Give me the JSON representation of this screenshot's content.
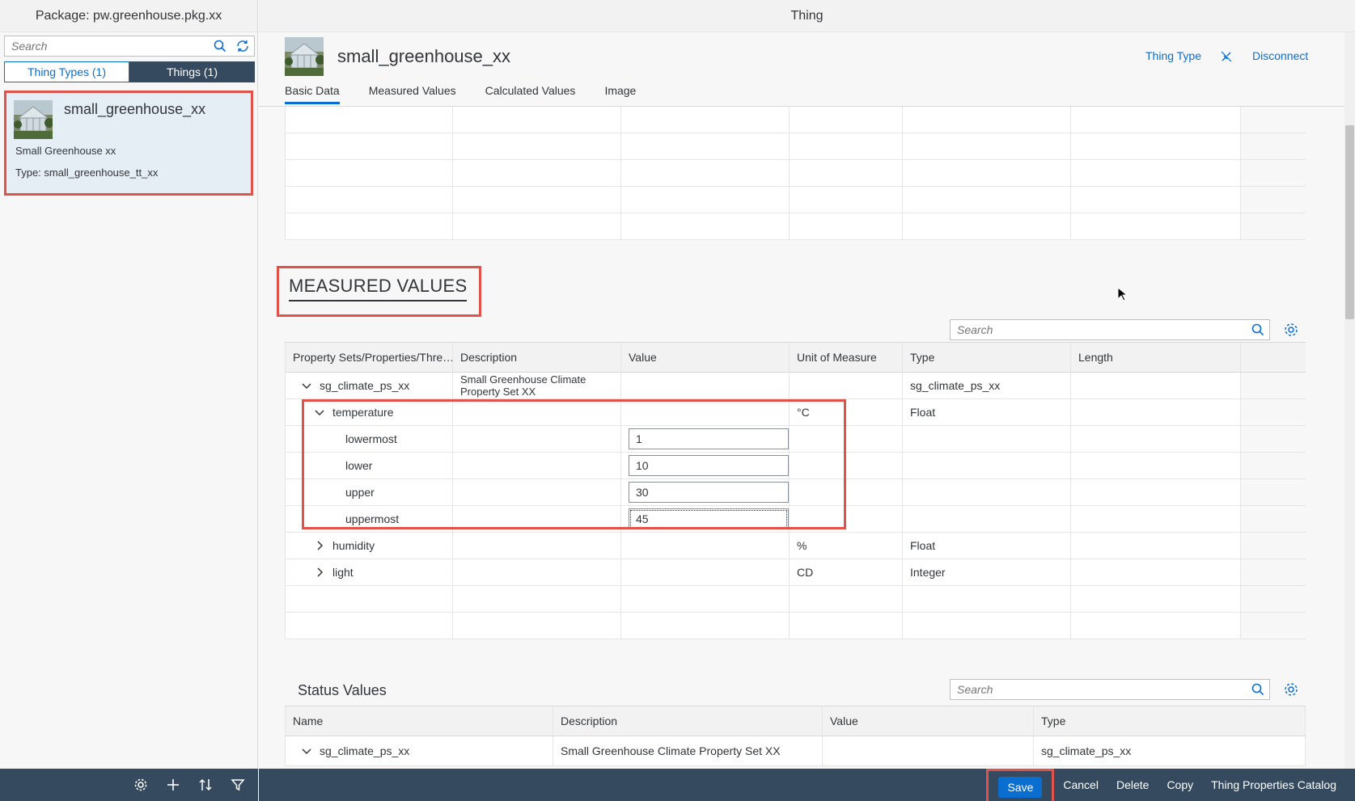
{
  "left": {
    "header": "Package: pw.greenhouse.pkg.xx",
    "search_placeholder": "Search",
    "tabs": [
      "Thing Types (1)",
      "Things (1)"
    ],
    "card": {
      "title": "small_greenhouse_xx",
      "description": "Small Greenhouse xx",
      "type": "Type: small_greenhouse_tt_xx"
    }
  },
  "main": {
    "header": "Thing",
    "title": "small_greenhouse_xx",
    "actions": {
      "thing_type": "Thing Type",
      "disconnect": "Disconnect"
    },
    "tabs": [
      "Basic Data",
      "Measured Values",
      "Calculated Values",
      "Image"
    ],
    "measured_values": {
      "title": "MEASURED VALUES",
      "search_placeholder": "Search",
      "columns": [
        "Property Sets/Properties/Thre…",
        "Description",
        "Value",
        "Unit of Measure",
        "Type",
        "Length"
      ],
      "rows": [
        {
          "name": "sg_climate_ps_xx",
          "description": "Small Greenhouse Climate Property Set XX",
          "value": "",
          "unit": "",
          "type": "sg_climate_ps_xx",
          "length": ""
        },
        {
          "name": "temperature",
          "description": "",
          "value": "",
          "unit": "°C",
          "type": "Float",
          "length": ""
        },
        {
          "name": "lowermost",
          "description": "",
          "value": "1",
          "unit": "",
          "type": "",
          "length": ""
        },
        {
          "name": "lower",
          "description": "",
          "value": "10",
          "unit": "",
          "type": "",
          "length": ""
        },
        {
          "name": "upper",
          "description": "",
          "value": "30",
          "unit": "",
          "type": "",
          "length": ""
        },
        {
          "name": "uppermost",
          "description": "",
          "value": "45",
          "unit": "",
          "type": "",
          "length": ""
        },
        {
          "name": "humidity",
          "description": "",
          "value": "",
          "unit": "%",
          "type": "Float",
          "length": ""
        },
        {
          "name": "light",
          "description": "",
          "value": "",
          "unit": "CD",
          "type": "Integer",
          "length": ""
        }
      ]
    },
    "status_values": {
      "title": "Status Values",
      "search_placeholder": "Search",
      "columns": [
        "Name",
        "Description",
        "Value",
        "Type"
      ],
      "rows": [
        {
          "name": "sg_climate_ps_xx",
          "description": "Small Greenhouse Climate Property Set XX",
          "value": "",
          "type": "sg_climate_ps_xx"
        }
      ]
    }
  },
  "footer": {
    "save": "Save",
    "cancel": "Cancel",
    "delete": "Delete",
    "copy": "Copy",
    "catalog": "Thing Properties Catalog"
  },
  "colors": {
    "accent": "#0a6ed1",
    "shell": "#354a5f",
    "highlight": "#e0524a"
  }
}
